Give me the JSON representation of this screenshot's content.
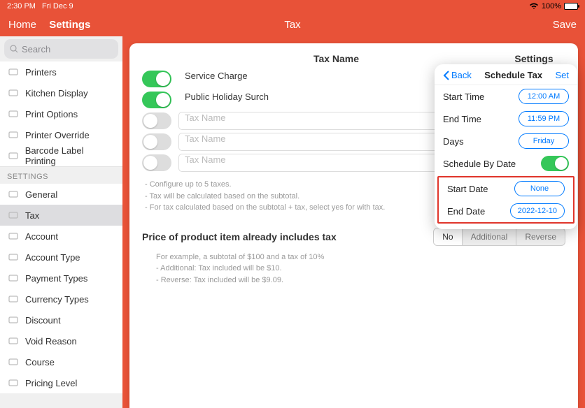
{
  "statusbar": {
    "time": "2:30 PM",
    "date": "Fri Dec 9",
    "battery": "100%"
  },
  "navbar": {
    "home": "Home",
    "settings": "Settings",
    "title": "Tax",
    "save": "Save"
  },
  "search": {
    "placeholder": "Search"
  },
  "sidebar": {
    "top": [
      {
        "icon": "printer-icon",
        "label": "Printers"
      },
      {
        "icon": "kitchen-icon",
        "label": "Kitchen Display"
      },
      {
        "icon": "print-options-icon",
        "label": "Print Options"
      },
      {
        "icon": "printer-override-icon",
        "label": "Printer Override"
      },
      {
        "icon": "barcode-icon",
        "label": "Barcode Label Printing"
      }
    ],
    "section_label": "SETTINGS",
    "settings": [
      {
        "icon": "gear-icon",
        "label": "General"
      },
      {
        "icon": "tax-icon",
        "label": "Tax",
        "selected": true
      },
      {
        "icon": "account-icon",
        "label": "Account"
      },
      {
        "icon": "account-type-icon",
        "label": "Account Type"
      },
      {
        "icon": "payment-icon",
        "label": "Payment Types"
      },
      {
        "icon": "currency-icon",
        "label": "Currency Types"
      },
      {
        "icon": "discount-icon",
        "label": "Discount"
      },
      {
        "icon": "void-icon",
        "label": "Void Reason"
      },
      {
        "icon": "course-icon",
        "label": "Course"
      },
      {
        "icon": "pricing-icon",
        "label": "Pricing Level"
      }
    ]
  },
  "tax": {
    "header_name": "Tax Name",
    "header_settings": "Settings",
    "rows": [
      {
        "on": true,
        "name": "Service Charge",
        "placeholder": false
      },
      {
        "on": true,
        "name": "Public Holiday Surch",
        "placeholder": false
      },
      {
        "on": false,
        "name": "Tax Name",
        "placeholder": true
      },
      {
        "on": false,
        "name": "Tax Name",
        "placeholder": true
      },
      {
        "on": false,
        "name": "Tax Name",
        "placeholder": true
      }
    ],
    "settings_btn": "Settings",
    "notes": {
      "l1": "- Configure up to 5 taxes.",
      "l2": "- Tax will be calculated based on the subtotal.",
      "l3": "- For tax calculated based on the subtotal + tax, select yes for with tax."
    },
    "section2_title": "Price of product item already includes tax",
    "seg": {
      "no": "No",
      "additional": "Additional",
      "reverse": "Reverse"
    },
    "notes2": {
      "l1": "For example, a subtotal of $100 and a tax of 10%",
      "l2": "- Additional: Tax included will be $10.",
      "l3": "- Reverse: Tax included will be $9.09."
    }
  },
  "popover": {
    "back": "Back",
    "title": "Schedule Tax",
    "set": "Set",
    "start_time": {
      "label": "Start Time",
      "value": "12:00 AM"
    },
    "end_time": {
      "label": "End Time",
      "value": "11:59 PM"
    },
    "days": {
      "label": "Days",
      "value": "Friday"
    },
    "by_date": {
      "label": "Schedule By Date"
    },
    "start_date": {
      "label": "Start Date",
      "value": "None"
    },
    "end_date": {
      "label": "End Date",
      "value": "2022-12-10"
    }
  }
}
